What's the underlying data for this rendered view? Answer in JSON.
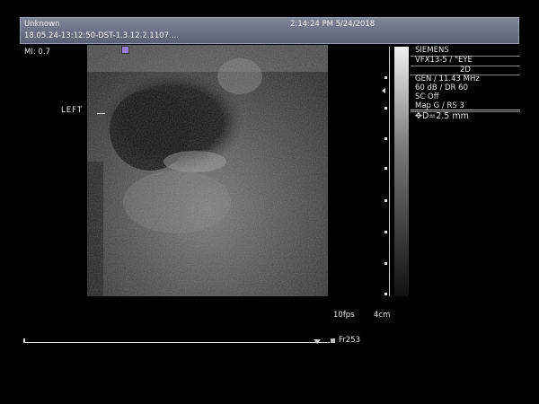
{
  "header": {
    "patient_name": "Unknown",
    "datetime": "2:14:24 PM 5/24/2018",
    "study_id": "18.05.24-13:12:50-DST-1.3.12.2.1107...."
  },
  "mechanical_index": "MI: 0.7",
  "side_label": "LEFT",
  "info": {
    "manufacturer": "SIEMENS",
    "transducer_preset": "VFX13-5 / \"EYE",
    "mode": "2D",
    "frequency": "GEN / 11.43 MHz",
    "gain_dr": "60 dB / DR 60",
    "sc": "SC Off",
    "map": "Map G / RS 3",
    "measurement": "D=2.5 mm"
  },
  "frame_rate": "10fps",
  "depth": "4cm",
  "frame_label": "Fr253",
  "colors": {
    "header_bg": "#6b7285",
    "background": "#000000",
    "text": "#e6e6e6"
  },
  "scrub_progress": 0.96
}
